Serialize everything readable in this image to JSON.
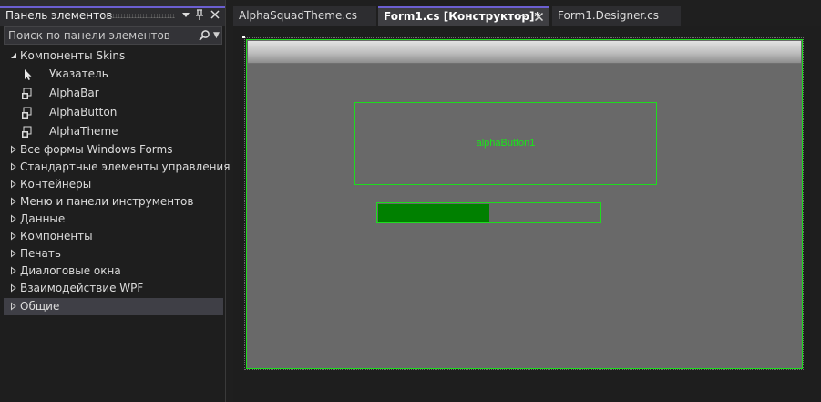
{
  "toolbox": {
    "title": "Панель элементов",
    "search_placeholder": "Поиск по панели элементов",
    "sections": [
      {
        "label": "Компоненты Skins",
        "expanded": true
      },
      {
        "label": "Все формы Windows Forms",
        "expanded": false
      },
      {
        "label": "Стандартные элементы управления",
        "expanded": false
      },
      {
        "label": "Контейнеры",
        "expanded": false
      },
      {
        "label": "Меню и панели инструментов",
        "expanded": false
      },
      {
        "label": "Данные",
        "expanded": false
      },
      {
        "label": "Компоненты",
        "expanded": false
      },
      {
        "label": "Печать",
        "expanded": false
      },
      {
        "label": "Диалоговые окна",
        "expanded": false
      },
      {
        "label": "Взаимодействие WPF",
        "expanded": false
      },
      {
        "label": "Общие",
        "expanded": false,
        "selected": true
      }
    ],
    "skin_items": [
      {
        "label": "Указатель",
        "icon": "pointer-icon"
      },
      {
        "label": "AlphaBar",
        "icon": "component-icon"
      },
      {
        "label": "AlphaButton",
        "icon": "component-icon"
      },
      {
        "label": "AlphaTheme",
        "icon": "component-icon"
      }
    ]
  },
  "tabs": [
    {
      "label": "AlphaSquadTheme.cs",
      "active": false
    },
    {
      "label": "Form1.cs [Конструктор]*",
      "active": true
    },
    {
      "label": "Form1.Designer.cs",
      "active": false
    }
  ],
  "designer": {
    "button_text": "alphaButton1",
    "progress_fraction": 0.5
  },
  "colors": {
    "accent": "#6b5fd1",
    "control_border": "#1edc1e",
    "button_text": "#19e619",
    "progress_fill": "#008000",
    "form_background": "#696969"
  }
}
